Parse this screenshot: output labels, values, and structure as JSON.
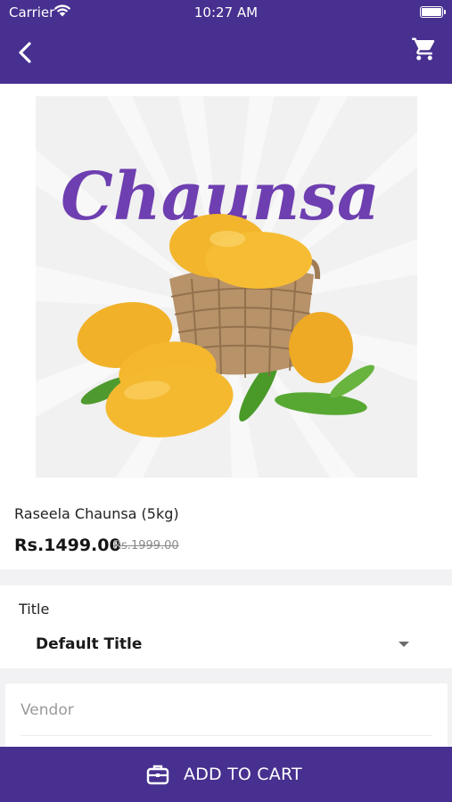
{
  "status_bar": {
    "carrier": "Carrier",
    "time": "10:27 AM",
    "icons": [
      "wifi-icon",
      "battery-icon"
    ]
  },
  "header": {
    "back_icon": "chevron-left-icon",
    "cart_icon": "cart-icon",
    "background_color": "#47308f"
  },
  "product": {
    "image_text": "Chaunsa",
    "name": "Raseela Chaunsa (5kg)",
    "price": "Rs.1499.00",
    "old_price": "Rs.1999.00"
  },
  "variant": {
    "label": "Title",
    "value": "Default Title",
    "icon": "dropdown-arrow-icon"
  },
  "vendor": {
    "placeholder": "Vendor",
    "value": ""
  },
  "footer": {
    "add_to_cart_label": "ADD TO CART",
    "icon": "briefcase-icon",
    "background_color": "#47308f"
  }
}
